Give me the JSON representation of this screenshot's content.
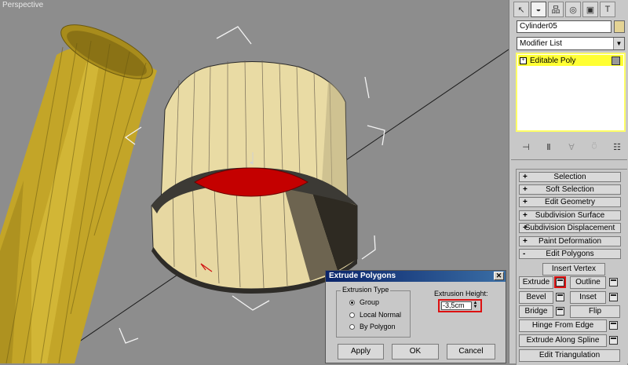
{
  "viewport": {
    "label": "Perspective"
  },
  "panel": {
    "tabs": [
      {
        "icon": "create-arrow-icon",
        "glyph": "↖"
      },
      {
        "icon": "modify-icon",
        "glyph": "◒"
      },
      {
        "icon": "hierarchy-icon",
        "glyph": "品"
      },
      {
        "icon": "motion-icon",
        "glyph": "◎"
      },
      {
        "icon": "display-icon",
        "glyph": "▣"
      },
      {
        "icon": "utilities-hammer-icon",
        "glyph": "T"
      }
    ],
    "object_name": "Cylinder05",
    "object_color": "#e4d394",
    "modifier_list": "Modifier List",
    "stack_item": "Editable Poly",
    "stack_tools": [
      {
        "icon": "pin-stack-icon",
        "glyph": "⊣"
      },
      {
        "icon": "show-end-result-icon",
        "glyph": "Ⅱ"
      },
      {
        "icon": "make-unique-icon",
        "glyph": "∀"
      },
      {
        "icon": "remove-modifier-icon",
        "glyph": "⍥"
      },
      {
        "icon": "configure-modifier-sets-icon",
        "glyph": "☷"
      }
    ],
    "rollouts": [
      {
        "sign": "+",
        "label": "Selection"
      },
      {
        "sign": "+",
        "label": "Soft Selection"
      },
      {
        "sign": "+",
        "label": "Edit Geometry"
      },
      {
        "sign": "+",
        "label": "Subdivision Surface"
      },
      {
        "sign": "+",
        "label": "Subdivision Displacement"
      },
      {
        "sign": "+",
        "label": "Paint Deformation"
      },
      {
        "sign": "-",
        "label": "Edit Polygons"
      }
    ],
    "edit_polygons": {
      "insert_vertex": "Insert Vertex",
      "extrude": "Extrude",
      "outline": "Outline",
      "bevel": "Bevel",
      "inset": "Inset",
      "bridge": "Bridge",
      "flip": "Flip",
      "hinge_from_edge": "Hinge From Edge",
      "extrude_along_spline": "Extrude Along Spline",
      "edit_triangulation": "Edit Triangulation"
    }
  },
  "dialog": {
    "title": "Extrude Polygons",
    "group_label": "Extrusion Type",
    "options": [
      "Group",
      "Local Normal",
      "By Polygon"
    ],
    "selected_option": "Group",
    "height_label": "Extrusion Height:",
    "height_value": "-3,5cm",
    "apply": "Apply",
    "ok": "OK",
    "cancel": "Cancel"
  },
  "colors": {
    "viewport_bg": "#8d8d8d",
    "cylinder_yellow": "#c8aa2a",
    "tube_cream": "#eadca8",
    "selected_face_red": "#c40000",
    "highlight_red": "#dd1111",
    "stack_yellow": "#ffff33"
  }
}
